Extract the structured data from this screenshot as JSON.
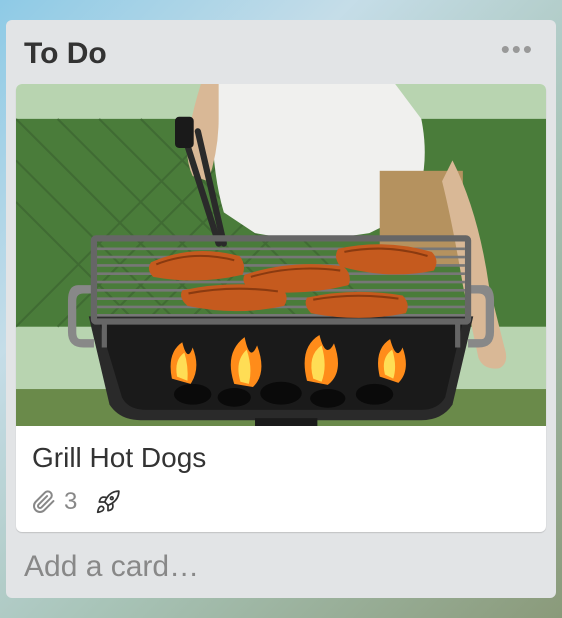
{
  "list": {
    "title": "To Do",
    "menu_icon": "more-horizontal-icon",
    "add_card_label": "Add a card…"
  },
  "card": {
    "title": "Grill Hot Dogs",
    "attachment_count": "3",
    "icons": {
      "attachment": "paperclip-icon",
      "powerup": "rocket-icon"
    },
    "cover": {
      "alt": "Hot dogs cooking on a charcoal grill with flames"
    }
  }
}
